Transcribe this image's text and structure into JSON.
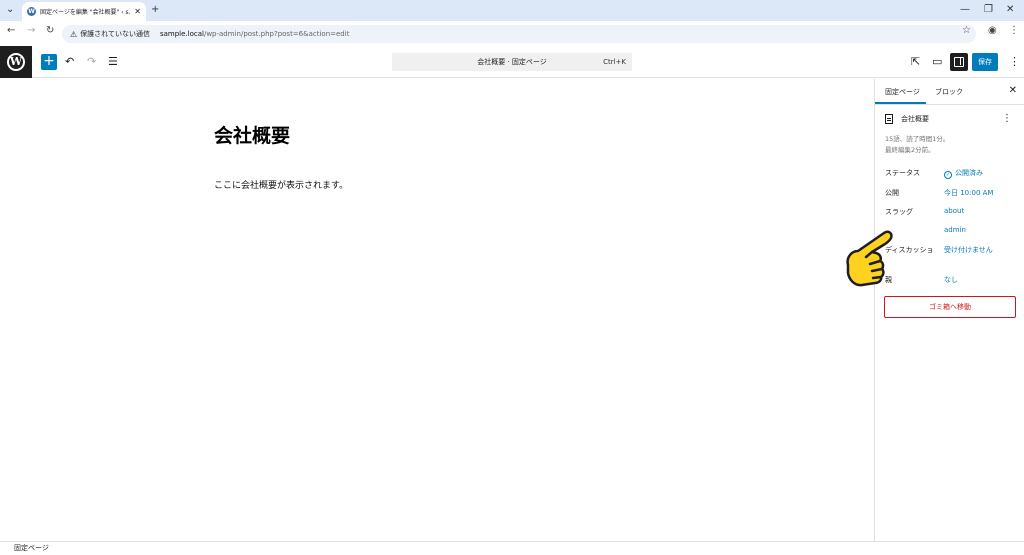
{
  "browser": {
    "tab_title": "固定ページを編集 \"会社概要\" ‹ s...",
    "security_label": "保護されていない通信",
    "url_host": "sample.local",
    "url_path": "/wp-admin/post.php?post=6&action=edit"
  },
  "header": {
    "command_label": "会社概要 · 固定ページ",
    "shortcut": "Ctrl+K",
    "save_label": "保存",
    "add_label": "+"
  },
  "editor": {
    "title": "会社概要",
    "body": "ここに会社概要が表示されます。"
  },
  "sidebar": {
    "tab_page": "固定ページ",
    "tab_block": "ブロック",
    "doc_title": "会社概要",
    "meta_line1": "15語、読了時間1分。",
    "meta_line2": "最終編集2分前。",
    "rows": [
      {
        "label": "ステータス",
        "value": "公開済み"
      },
      {
        "label": "公開",
        "value": "今日 10:00 AM"
      },
      {
        "label": "スラッグ",
        "value": "about"
      },
      {
        "label": "",
        "value": "admin"
      },
      {
        "label": "ディスカッショ",
        "value": "受け付けません"
      },
      {
        "label": "親",
        "value": "なし"
      }
    ],
    "trash_label": "ゴミ箱へ移動"
  },
  "footer": {
    "breadcrumb": "固定ページ"
  },
  "colors": {
    "accent": "#007cba",
    "danger": "#cc1818",
    "pointer": "#ffd21f"
  }
}
